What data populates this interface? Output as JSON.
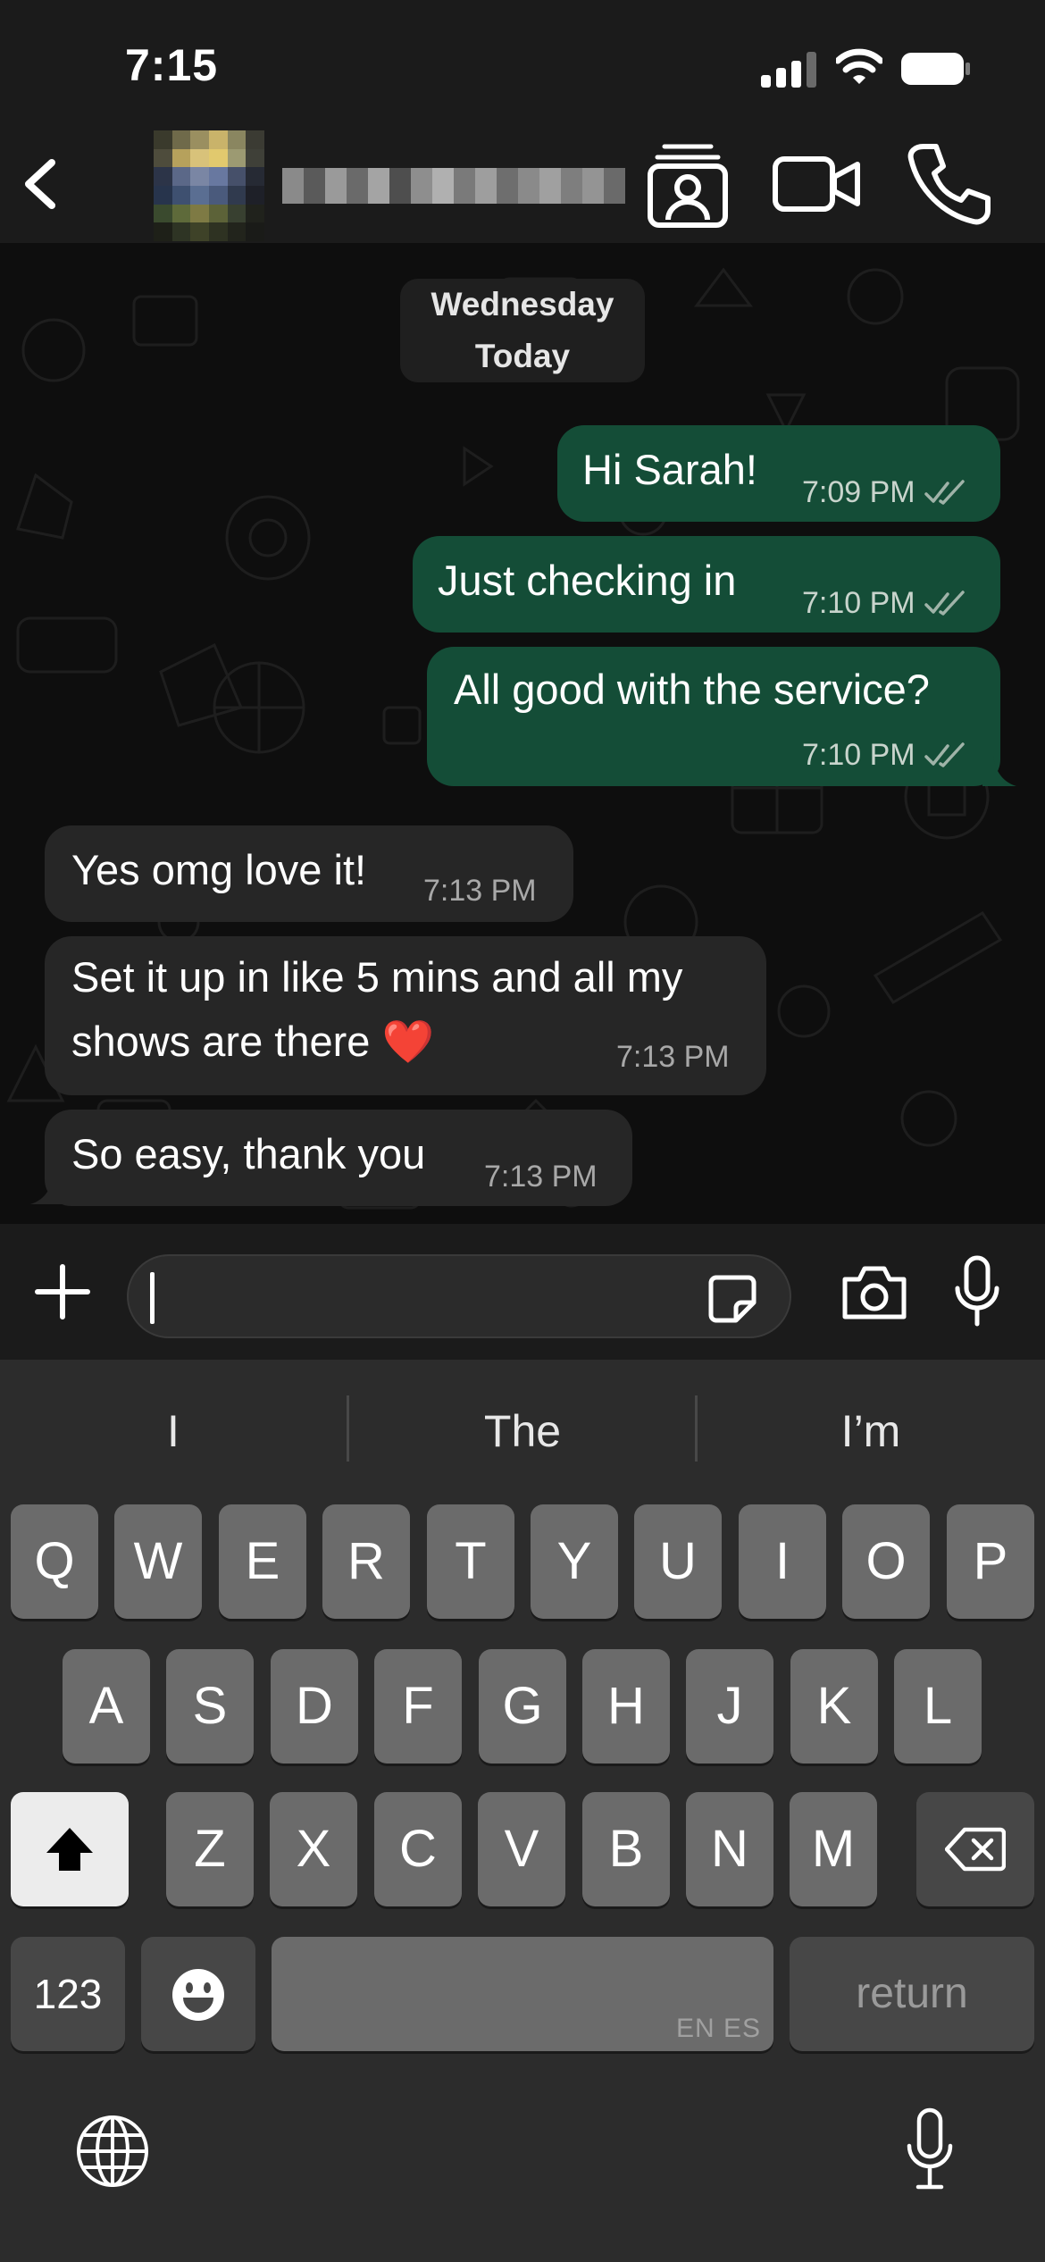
{
  "status_bar": {
    "time": "7:15"
  },
  "header": {
    "back_icon": "chevron-left-icon",
    "contact_name_pixelated": true,
    "icons": [
      "contact-card-icon",
      "video-camera-icon",
      "phone-icon"
    ]
  },
  "chat": {
    "date_chip": {
      "day": "Wednesday",
      "label": "Today"
    },
    "messages": [
      {
        "direction": "out",
        "text": "Hi Sarah!",
        "time": "7:09 PM",
        "status": "read"
      },
      {
        "direction": "out",
        "text": "Just checking in",
        "time": "7:10 PM",
        "status": "read"
      },
      {
        "direction": "out",
        "text": "All good with the service?",
        "time": "7:10 PM",
        "status": "read"
      },
      {
        "direction": "in",
        "text": "Yes omg love it!",
        "time": "7:13 PM"
      },
      {
        "direction": "in",
        "text": "Set it up in like 5 mins and all my shows are there ❤️",
        "time": "7:13 PM"
      },
      {
        "direction": "in",
        "text": "So easy, thank you",
        "time": "7:13 PM"
      }
    ]
  },
  "input_bar": {
    "value": "",
    "icons": [
      "plus-icon",
      "sticker-icon",
      "camera-icon",
      "microphone-icon"
    ]
  },
  "keyboard": {
    "suggestions": [
      "I",
      "The",
      "I’m"
    ],
    "row1": [
      "Q",
      "W",
      "E",
      "R",
      "T",
      "Y",
      "U",
      "I",
      "O",
      "P"
    ],
    "row2": [
      "A",
      "S",
      "D",
      "F",
      "G",
      "H",
      "J",
      "K",
      "L"
    ],
    "row3": [
      "Z",
      "X",
      "C",
      "V",
      "B",
      "N",
      "M"
    ],
    "numbers_label": "123",
    "space_languages": "EN ES",
    "return_label": "return",
    "icons": [
      "shift-icon",
      "backspace-icon",
      "emoji-icon",
      "globe-icon",
      "dictation-mic-icon"
    ]
  },
  "colors": {
    "outgoing_bubble": "#144d37",
    "incoming_bubble": "#262626",
    "chat_background": "#0e0e0e",
    "bar_background": "#1b1b1b",
    "keyboard_background": "#2c2c2c"
  }
}
